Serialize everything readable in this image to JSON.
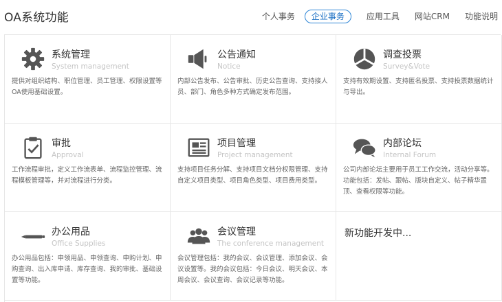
{
  "header": {
    "title": "OA系统功能",
    "tabs": [
      {
        "label": "个人事务",
        "active": false
      },
      {
        "label": "企业事务",
        "active": true
      },
      {
        "label": "应用工具",
        "active": false
      },
      {
        "label": "网站CRM",
        "active": false
      },
      {
        "label": "功能说明",
        "active": false
      }
    ]
  },
  "cards": [
    {
      "icon": "gear-icon",
      "title": "系统管理",
      "subtitle": "System management",
      "desc": "提供对组织结构、职位管理、员工管理、权限设置等OA使用基础设置。"
    },
    {
      "icon": "speaker-icon",
      "title": "公告通知",
      "subtitle": "Notice",
      "desc": "内部公告发布、公告审批、历史公告查询、支持接人员、部门、角色多种方式确定发布范围。"
    },
    {
      "icon": "pie-chart-icon",
      "title": "调查投票",
      "subtitle": "Survey&Vote",
      "desc": "支持有效期设置、支持匿名投票、支持投票数据统计与导出。"
    },
    {
      "icon": "clipboard-check-icon",
      "title": "审批",
      "subtitle": "Approval",
      "desc": "工作流程审批，定义工作流表单、流程监控管理、流程模板管理等，并对流程进行分类。"
    },
    {
      "icon": "document-icon",
      "title": "项目管理",
      "subtitle": "Project management",
      "desc": "支持项目任务分解、支持项目文档分权限管理、支持自定义项目类型、项目角色类型、项目费用类型。"
    },
    {
      "icon": "chat-bubbles-icon",
      "title": "内部论坛",
      "subtitle": "Internal Forum",
      "desc": "公司内部论坛主要用于员工工作交流，活动分享等。功能包括：发帖、跟帖、版块自定义、帖子精华置顶、查看权限等功能。"
    },
    {
      "icon": "pen-icon",
      "title": "办公用品",
      "subtitle": "Office Supplies",
      "desc": "办公用品包括：申领用品、申领查询、申购计划、申购查询、出入库申请、库存查询、我的审批、基础设置等功能。"
    },
    {
      "icon": "people-icon",
      "title": "会议管理",
      "subtitle": "The conference management",
      "desc": "会议管理包括：我的会议、会议管理、添加会议、会议设置等。我的会议包括：今日会议、明天会议、本周会议、会议查询、会议记录等功能。"
    },
    {
      "icon": "",
      "title": "新功能开发中...",
      "subtitle": "",
      "desc": ""
    }
  ],
  "colors": {
    "accent": "#2b84d6",
    "icon": "#555555",
    "border": "#e6e6e6",
    "subtitle": "#c4c4c4"
  }
}
